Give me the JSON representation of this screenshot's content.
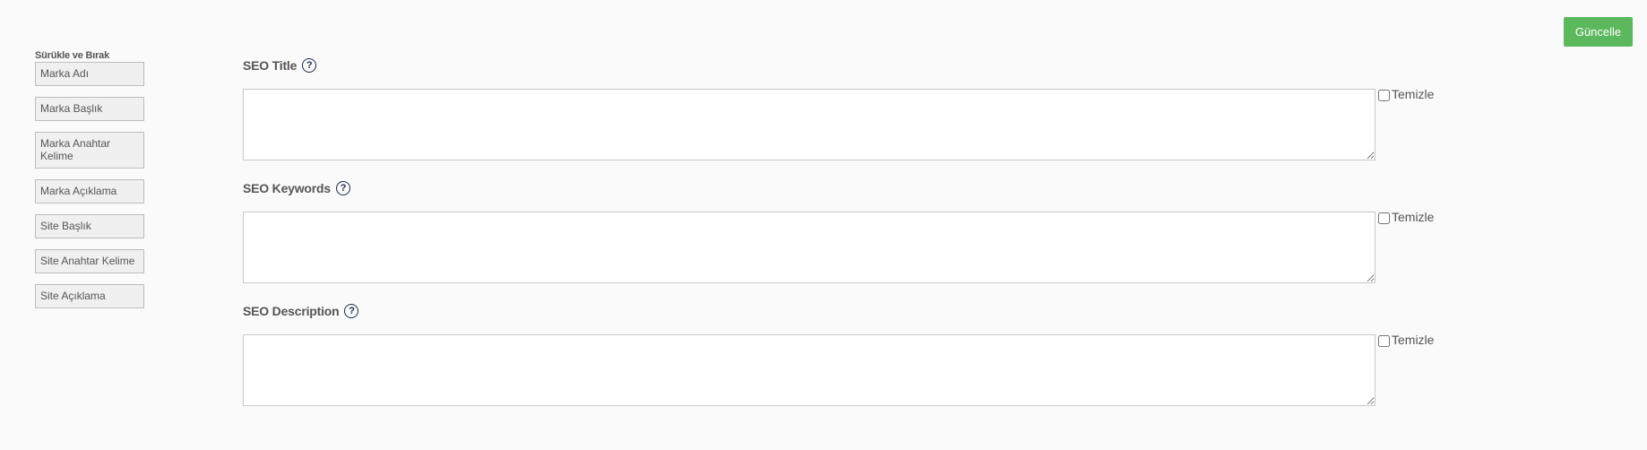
{
  "toolbar": {
    "update_label": "Güncelle",
    "update_color": "#5cb85c"
  },
  "dnd": {
    "title": "Sürükle ve Bırak",
    "items": [
      {
        "label": "Marka Adı"
      },
      {
        "label": "Marka Başlık"
      },
      {
        "label": "Marka Anahtar Kelime"
      },
      {
        "label": "Marka Açıklama"
      },
      {
        "label": "Site Başlık"
      },
      {
        "label": "Site Anahtar Kelime"
      },
      {
        "label": "Site Açıklama"
      }
    ]
  },
  "fields": [
    {
      "label": "SEO Title",
      "value": "",
      "clear_label": "Temizle",
      "clear_checked": false,
      "help_icon": "question-circle-icon"
    },
    {
      "label": "SEO Keywords",
      "value": "",
      "clear_label": "Temizle",
      "clear_checked": false,
      "help_icon": "question-circle-icon"
    },
    {
      "label": "SEO Description",
      "value": "",
      "clear_label": "Temizle",
      "clear_checked": false,
      "help_icon": "question-circle-icon"
    }
  ]
}
